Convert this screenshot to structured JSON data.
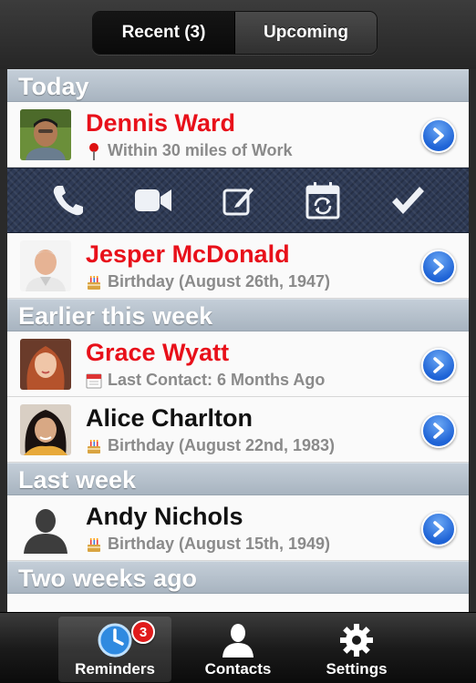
{
  "segmented_control": {
    "recent_label": "Recent (3)",
    "upcoming_label": "Upcoming",
    "selected": "recent"
  },
  "sections": [
    {
      "title": "Today"
    },
    {
      "title": "Earlier this week"
    },
    {
      "title": "Last week"
    },
    {
      "title": "Two weeks ago"
    }
  ],
  "contacts": [
    {
      "name": "Dennis Ward",
      "detail": "Within 30 miles of Work",
      "icon": "map-pin-icon",
      "name_color": "#e8101a"
    },
    {
      "name": "Jesper McDonald",
      "detail": "Birthday (August 26th, 1947)",
      "icon": "birthday-cake-icon",
      "name_color": "#e8101a"
    },
    {
      "name": "Grace Wyatt",
      "detail": "Last Contact: 6 Months Ago",
      "icon": "calendar-icon",
      "name_color": "#e8101a"
    },
    {
      "name": "Alice Charlton",
      "detail": "Birthday (August 22nd, 1983)",
      "icon": "birthday-cake-icon",
      "name_color": "#111111"
    },
    {
      "name": "Andy Nichols",
      "detail": "Birthday (August 15th, 1949)",
      "icon": "birthday-cake-icon",
      "name_color": "#111111"
    }
  ],
  "action_bar": [
    "phone-icon",
    "video-camera-icon",
    "compose-icon",
    "reschedule-calendar-icon",
    "checkmark-icon"
  ],
  "tab_bar": {
    "tabs": [
      {
        "label": "Reminders",
        "icon": "clock-icon"
      },
      {
        "label": "Contacts",
        "icon": "person-icon"
      },
      {
        "label": "Settings",
        "icon": "gear-icon"
      }
    ],
    "badge_count": "3",
    "selected": "Reminders"
  },
  "colors": {
    "accent_red": "#e8101a",
    "disclosure_blue": "#1e63d6",
    "section_header": "#b4c0cc"
  }
}
